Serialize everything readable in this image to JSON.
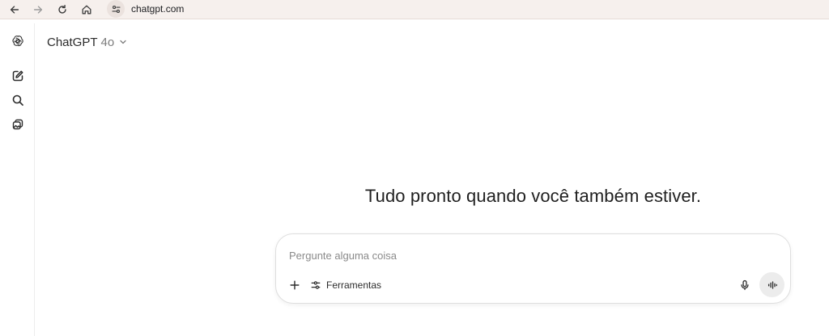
{
  "browser": {
    "url": "chatgpt.com",
    "icons": [
      "back-arrow-icon",
      "forward-arrow-icon",
      "reload-icon",
      "home-icon",
      "site-settings-icon"
    ]
  },
  "sidebar": {
    "icons": [
      "openai-logo-icon",
      "new-chat-icon",
      "search-icon",
      "library-icon"
    ]
  },
  "header": {
    "model_name": "ChatGPT",
    "model_version": "4o"
  },
  "main": {
    "headline": "Tudo pronto quando você também estiver."
  },
  "composer": {
    "placeholder": "Pergunte alguma coisa",
    "tools_label": "Ferramentas",
    "icons": [
      "plus-icon",
      "tools-icon",
      "microphone-icon",
      "voice-mode-icon"
    ]
  },
  "colors": {
    "browser_bar": "#f6f0ed",
    "text": "#0d0d0d",
    "muted": "#7d7d7d",
    "voice_button_bg": "#ececec"
  }
}
